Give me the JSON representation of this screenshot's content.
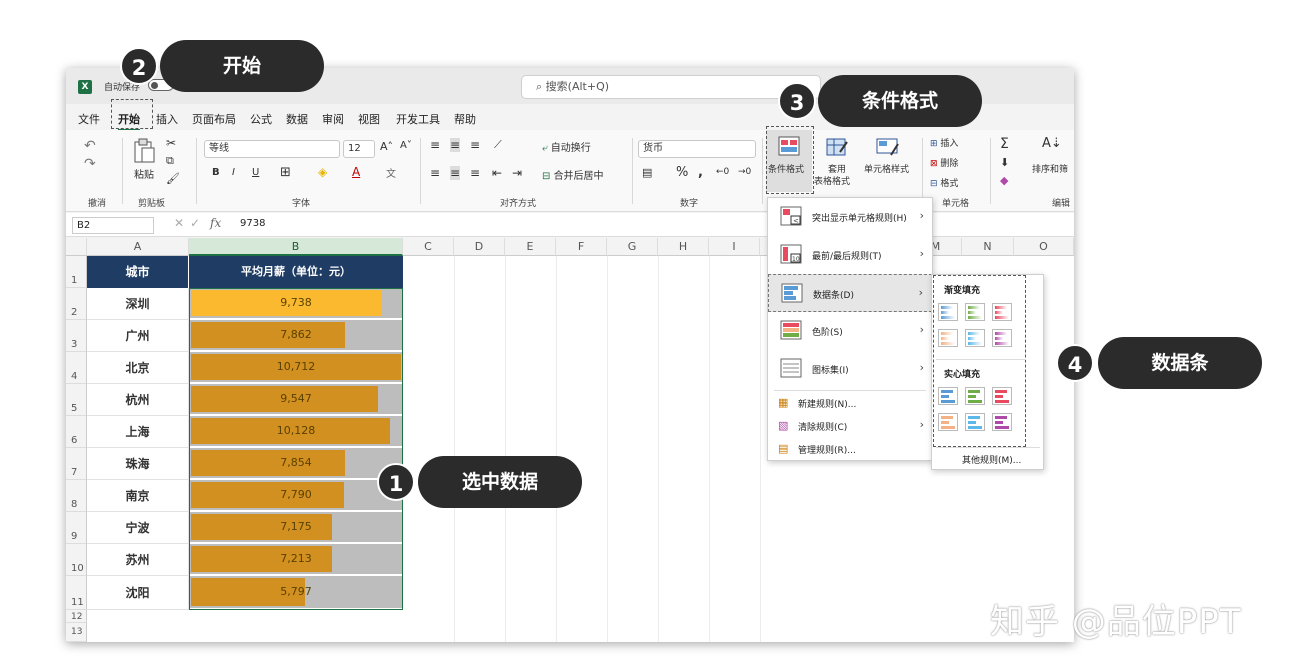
{
  "app": {
    "autosave_label": "自动保存",
    "search_placeholder": "搜索(Alt+Q)"
  },
  "menu": [
    "文件",
    "开始",
    "插入",
    "页面布局",
    "公式",
    "数据",
    "审阅",
    "视图",
    "开发工具",
    "帮助"
  ],
  "ribbon": {
    "groups": {
      "undo": "撤消",
      "clipboard": "剪贴板",
      "font": "字体",
      "alignment": "对齐方式",
      "number": "数字",
      "cells": "单元格",
      "editing": "编辑"
    },
    "paste_label": "粘贴",
    "font_name": "等线",
    "font_size": "12",
    "wrap_text": "自动换行",
    "merge_center": "合并后居中",
    "number_format": "货币",
    "cond_format": "条件格式",
    "table_format_line1": "套用",
    "table_format_line2": "表格格式",
    "cell_styles": "单元格样式",
    "insert": "插入",
    "delete": "删除",
    "format": "格式",
    "sort_filter": "排序和筛"
  },
  "formula_bar": {
    "name_box": "B2",
    "value": "9738"
  },
  "columns": [
    "A",
    "B",
    "C",
    "D",
    "E",
    "F",
    "G",
    "H",
    "I",
    "M",
    "N",
    "O"
  ],
  "rows": [
    "1",
    "2",
    "3",
    "4",
    "5",
    "6",
    "7",
    "8",
    "9",
    "10",
    "11",
    "12",
    "13"
  ],
  "table": {
    "header_city": "城市",
    "header_salary": "平均月薪（单位：元）",
    "rows": [
      {
        "city": "深圳",
        "value": 9738,
        "label": "9,738"
      },
      {
        "city": "广州",
        "value": 7862,
        "label": "7,862"
      },
      {
        "city": "北京",
        "value": 10712,
        "label": "10,712"
      },
      {
        "city": "杭州",
        "value": 9547,
        "label": "9,547"
      },
      {
        "city": "上海",
        "value": 10128,
        "label": "10,128"
      },
      {
        "city": "珠海",
        "value": 7854,
        "label": "7,854"
      },
      {
        "city": "南京",
        "value": 7790,
        "label": "7,790"
      },
      {
        "city": "宁波",
        "value": 7175,
        "label": "7,175"
      },
      {
        "city": "苏州",
        "value": 7213,
        "label": "7,213"
      },
      {
        "city": "沈阳",
        "value": 5797,
        "label": "5,797"
      }
    ],
    "bar_max": 10712
  },
  "cf_menu": {
    "highlight": "突出显示单元格规则(H)",
    "topbottom": "最前/最后规则(T)",
    "databar": "数据条(D)",
    "colorscale": "色阶(S)",
    "iconset": "图标集(I)",
    "new_rule": "新建规则(N)...",
    "clear_rule": "清除规则(C)",
    "manage_rule": "管理规则(R)..."
  },
  "databar_submenu": {
    "gradient": "渐变填充",
    "solid": "实心填充",
    "more": "其他规则(M)...",
    "colors": [
      "#5b9bd5",
      "#70ad47",
      "#e84a5f",
      "#f4b183",
      "#5bb8e8",
      "#b04aa8"
    ]
  },
  "callouts": {
    "c1_num": "1",
    "c1_text": "选中数据",
    "c2_num": "2",
    "c2_text": "开始",
    "c3_num": "3",
    "c3_text": "条件格式",
    "c4_num": "4",
    "c4_text": "数据条"
  },
  "watermark": "知乎 @品位PPT",
  "colors": {
    "header_bg": "#1f3c64",
    "bar": "#d1901f",
    "bar_first": "#fbb930",
    "bar_track": "#bdbdbd",
    "excel_green": "#1e7145"
  }
}
